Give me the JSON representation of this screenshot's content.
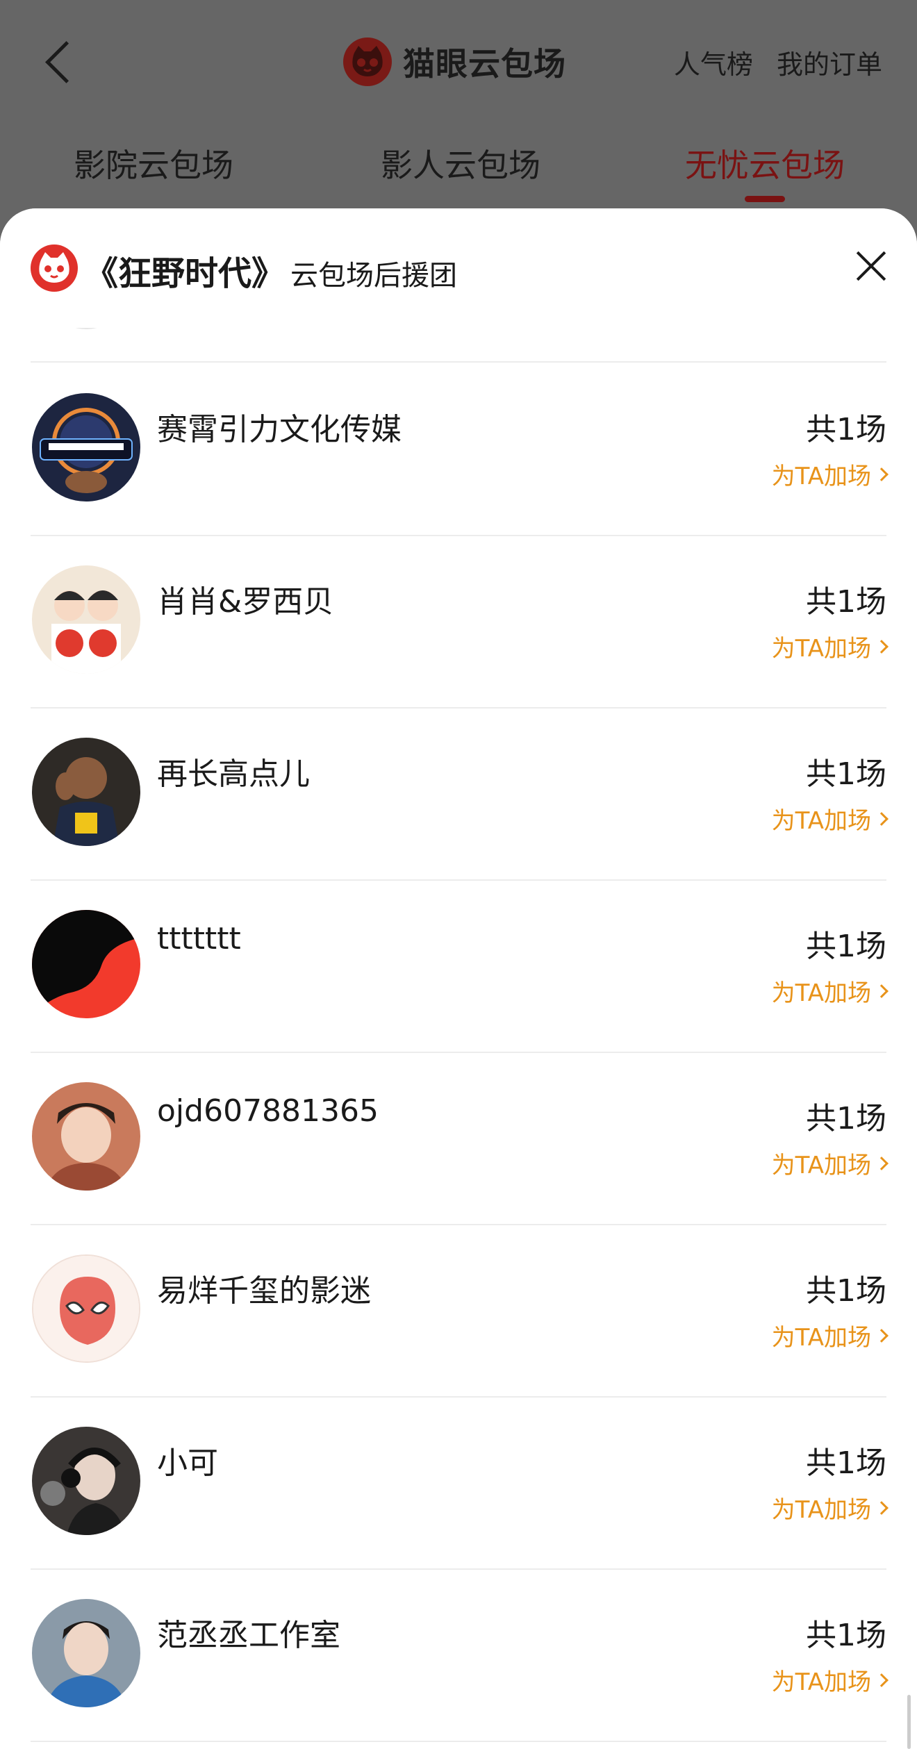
{
  "topbar": {
    "app_title": "猫眼云包场",
    "rank_link": "人气榜",
    "orders_link": "我的订单",
    "tabs": [
      "影院云包场",
      "影人云包场",
      "无忧云包场"
    ],
    "active_tab_index": 2
  },
  "sheet": {
    "title": "《狂野时代》",
    "subtitle": "云包场后援团"
  },
  "list": [
    {
      "name": "赛霄引力文化传媒",
      "count": "共1场",
      "action": "为TA加场",
      "avatar": "cybershown-gravity-logo"
    },
    {
      "name": "肖肖&罗西贝",
      "count": "共1场",
      "action": "为TA加场",
      "avatar": "cartoon-couple"
    },
    {
      "name": "再长高点儿",
      "count": "共1场",
      "action": "为TA加场",
      "avatar": "basketball-player"
    },
    {
      "name": "ttttttt",
      "count": "共1场",
      "action": "为TA加场",
      "avatar": "red-black-poster"
    },
    {
      "name": "ojd607881365",
      "count": "共1场",
      "action": "为TA加场",
      "avatar": "young-man-portrait"
    },
    {
      "name": "易烊千玺的影迷",
      "count": "共1场",
      "action": "为TA加场",
      "avatar": "spider-mask"
    },
    {
      "name": "小可",
      "count": "共1场",
      "action": "为TA加场",
      "avatar": "singer-headphones"
    },
    {
      "name": "范丞丞工作室",
      "count": "共1场",
      "action": "为TA加场",
      "avatar": "man-blue-shirt"
    }
  ],
  "colors": {
    "accent_red": "#e0312b",
    "action_orange": "#e8931a",
    "overlay_gray": "#666666"
  }
}
